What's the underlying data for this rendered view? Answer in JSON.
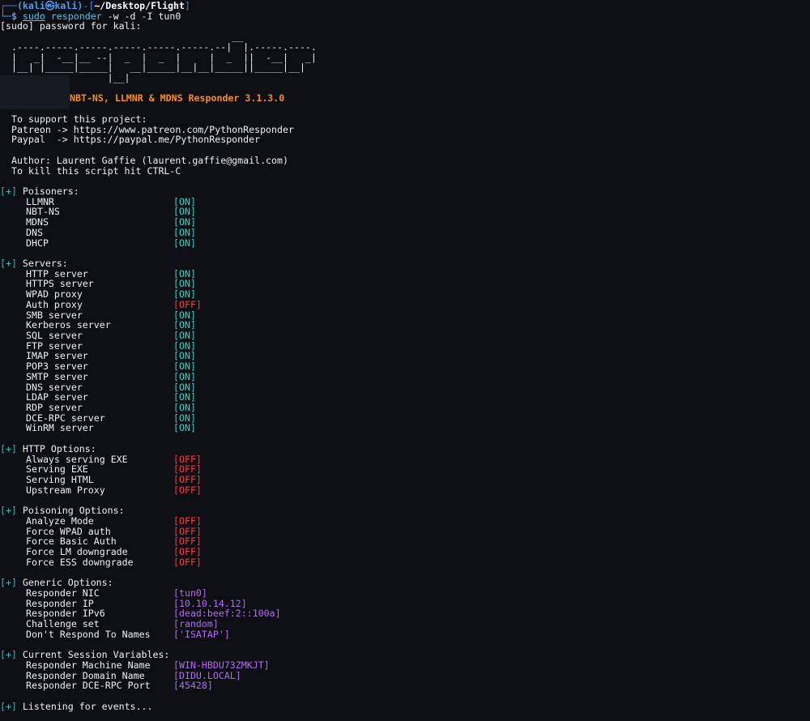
{
  "prompt": {
    "user_host": "(kali㉿kali)",
    "path": "~/Desktop/Flight",
    "command_sudo": "sudo",
    "command_name": "responder",
    "command_args": " -w -d -I tun0"
  },
  "sudo_prompt": "[sudo] password for kali:",
  "banner": [
    "                                         __",
    "  .----.-----.-----.-----.-----.-----.--|  |.-----.----.",
    "  |   _|  -__|__ --|  _  |  _  |     |  _  ||  -__|   _|",
    "  |__| |_____|_____|   __|_____|__|__|_____||_____|__|",
    "                   |__|"
  ],
  "title": "NBT-NS, LLMNR & MDNS Responder 3.1.3.0",
  "support": {
    "line1": "  To support this project:",
    "line2": "  Patreon -> https://www.patreon.com/PythonResponder",
    "line3": "  Paypal  -> https://paypal.me/PythonResponder"
  },
  "author": {
    "line1": "  Author: Laurent Gaffie (laurent.gaffie@gmail.com)",
    "line2": "  To kill this script hit CTRL-C"
  },
  "plus_marker": "[+]",
  "poisoners": {
    "header": " Poisoners:",
    "items": [
      {
        "label": "LLMNR",
        "value": "[ON]"
      },
      {
        "label": "NBT-NS",
        "value": "[ON]"
      },
      {
        "label": "MDNS",
        "value": "[ON]"
      },
      {
        "label": "DNS",
        "value": "[ON]"
      },
      {
        "label": "DHCP",
        "value": "[ON]"
      }
    ]
  },
  "servers": {
    "header": " Servers:",
    "items": [
      {
        "label": "HTTP server",
        "value": "[ON]"
      },
      {
        "label": "HTTPS server",
        "value": "[ON]"
      },
      {
        "label": "WPAD proxy",
        "value": "[ON]"
      },
      {
        "label": "Auth proxy",
        "value": "[OFF]"
      },
      {
        "label": "SMB server",
        "value": "[ON]"
      },
      {
        "label": "Kerberos server",
        "value": "[ON]"
      },
      {
        "label": "SQL server",
        "value": "[ON]"
      },
      {
        "label": "FTP server",
        "value": "[ON]"
      },
      {
        "label": "IMAP server",
        "value": "[ON]"
      },
      {
        "label": "POP3 server",
        "value": "[ON]"
      },
      {
        "label": "SMTP server",
        "value": "[ON]"
      },
      {
        "label": "DNS server",
        "value": "[ON]"
      },
      {
        "label": "LDAP server",
        "value": "[ON]"
      },
      {
        "label": "RDP server",
        "value": "[ON]"
      },
      {
        "label": "DCE-RPC server",
        "value": "[ON]"
      },
      {
        "label": "WinRM server",
        "value": "[ON]"
      }
    ]
  },
  "http_options": {
    "header": " HTTP Options:",
    "items": [
      {
        "label": "Always serving EXE",
        "value": "[OFF]"
      },
      {
        "label": "Serving EXE",
        "value": "[OFF]"
      },
      {
        "label": "Serving HTML",
        "value": "[OFF]"
      },
      {
        "label": "Upstream Proxy",
        "value": "[OFF]"
      }
    ]
  },
  "poisoning_options": {
    "header": " Poisoning Options:",
    "items": [
      {
        "label": "Analyze Mode",
        "value": "[OFF]"
      },
      {
        "label": "Force WPAD auth",
        "value": "[OFF]"
      },
      {
        "label": "Force Basic Auth",
        "value": "[OFF]"
      },
      {
        "label": "Force LM downgrade",
        "value": "[OFF]"
      },
      {
        "label": "Force ESS downgrade",
        "value": "[OFF]"
      }
    ]
  },
  "generic_options": {
    "header": " Generic Options:",
    "items": [
      {
        "label": "Responder NIC",
        "value": "[tun0]"
      },
      {
        "label": "Responder IP",
        "value": "[10.10.14.12]"
      },
      {
        "label": "Responder IPv6",
        "value": "[dead:beef:2::100a]"
      },
      {
        "label": "Challenge set",
        "value": "[random]"
      },
      {
        "label": "Don't Respond To Names",
        "value": "['ISATAP']"
      }
    ]
  },
  "session_variables": {
    "header": " Current Session Variables:",
    "items": [
      {
        "label": "Responder Machine Name",
        "value": "[WIN-HBDU73ZMKJT]"
      },
      {
        "label": "Responder Domain Name",
        "value": "[DIDU.LOCAL]"
      },
      {
        "label": "Responder DCE-RPC Port",
        "value": "[45428]"
      }
    ]
  },
  "listening": " Listening for events...",
  "colors": {
    "background": "#0d0f14",
    "on": "#2fd6c8",
    "off": "#ff3a3a",
    "value": "#b26cf0",
    "title": "#ff8c1a",
    "prompt": "#4a9ef0"
  }
}
